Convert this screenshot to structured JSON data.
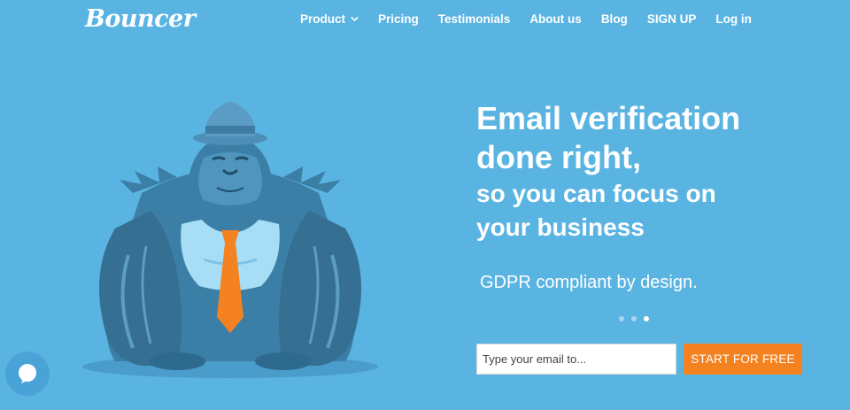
{
  "header": {
    "logo_text": "Bouncer",
    "nav": [
      {
        "label": "Product",
        "has_dropdown": true
      },
      {
        "label": "Pricing"
      },
      {
        "label": "Testimonials"
      },
      {
        "label": "About us"
      },
      {
        "label": "Blog"
      },
      {
        "label": "SIGN UP"
      },
      {
        "label": "Log in"
      }
    ]
  },
  "hero": {
    "title_line1": "Email verification",
    "title_line2": "done right,",
    "subtitle_line1": "so you can focus on",
    "subtitle_line2": "your business",
    "note": "GDPR compliant by design.",
    "slides": {
      "count": 3,
      "active_index": 2
    },
    "email_placeholder": "Type your email to...",
    "cta_label": "START FOR FREE"
  },
  "colors": {
    "background": "#5ab4e2",
    "cta": "#f58220",
    "gorilla_body": "#3b7fa6",
    "tie": "#f58220"
  },
  "icons": {
    "chevron": "chevron-down-icon",
    "chat": "chat-bubble-icon",
    "illustration": "gorilla-illustration"
  }
}
